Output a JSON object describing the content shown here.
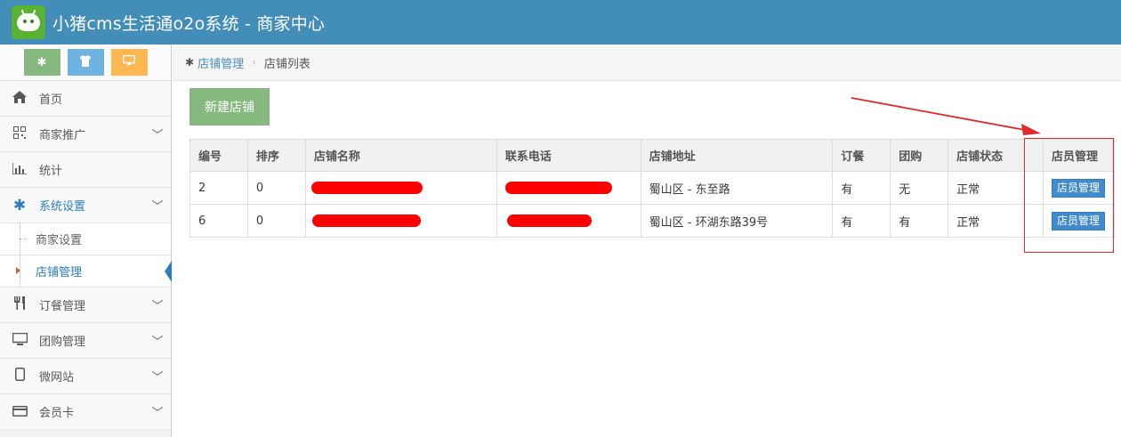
{
  "header": {
    "title": "小猪cms生活通o2o系统 - 商家中心",
    "logo_icon": "pig-logo-icon"
  },
  "shortcuts": [
    {
      "icon": "gear-icon",
      "color": "#87b87f"
    },
    {
      "icon": "shirt-icon",
      "color": "#6fb3e0"
    },
    {
      "icon": "monitor-icon",
      "color": "#ffb752"
    }
  ],
  "sidebar": {
    "items": [
      {
        "label": "首页",
        "icon": "home-icon"
      },
      {
        "label": "商家推广",
        "icon": "qrcode-icon"
      },
      {
        "label": "统计",
        "icon": "bar-chart-icon"
      },
      {
        "label": "系统设置",
        "icon": "gear-icon"
      },
      {
        "label": "订餐管理",
        "icon": "cutlery-icon"
      },
      {
        "label": "团购管理",
        "icon": "monitor-icon"
      },
      {
        "label": "微网站",
        "icon": "tablet-icon"
      },
      {
        "label": "会员卡",
        "icon": "credit-card-icon"
      }
    ],
    "sub_items": [
      {
        "label": "商家设置"
      },
      {
        "label": "店铺管理"
      }
    ]
  },
  "breadcrumb": {
    "parent": "店铺管理",
    "current": "店铺列表"
  },
  "toolbar": {
    "new_store_label": "新建店铺"
  },
  "table": {
    "headers": [
      "编号",
      "排序",
      "店铺名称",
      "联系电话",
      "店铺地址",
      "订餐",
      "团购",
      "店铺状态",
      "店员管理"
    ],
    "rows": [
      {
        "id": "2",
        "sort": "0",
        "address": "蜀山区 - 东至路",
        "order": "有",
        "group": "无",
        "status": "正常",
        "action": "店员管理"
      },
      {
        "id": "6",
        "sort": "0",
        "address": "蜀山区 - 环湖东路39号",
        "order": "有",
        "group": "有",
        "status": "正常",
        "action": "店员管理"
      }
    ]
  },
  "colors": {
    "navbar": "#438eb9",
    "primary": "#428bca",
    "success": "#87b87f",
    "annotation": "#e0292c",
    "redaction": "#ff0000"
  }
}
